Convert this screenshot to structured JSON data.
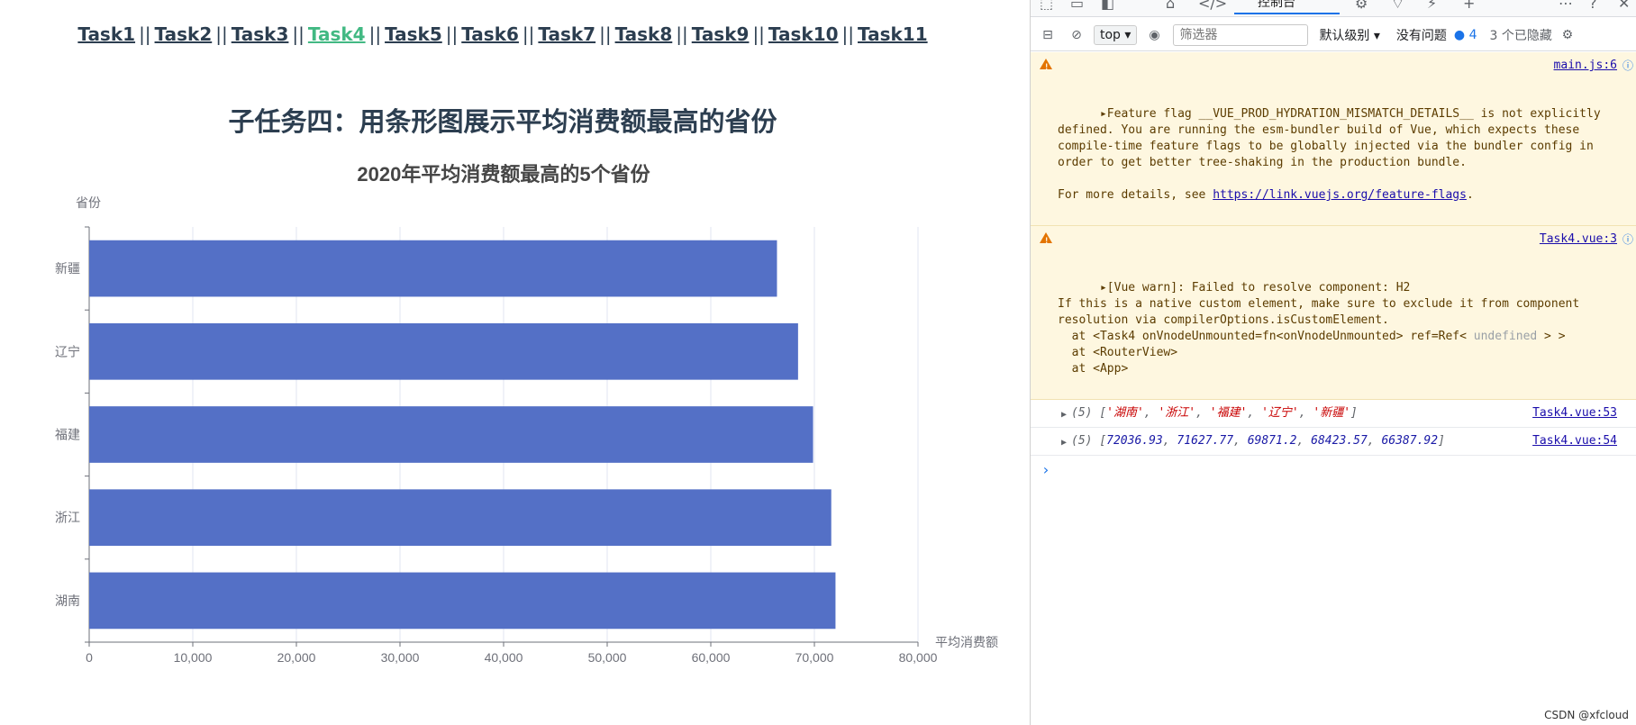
{
  "nav": {
    "links": [
      {
        "label": "Task1",
        "active": false
      },
      {
        "label": "Task2",
        "active": false
      },
      {
        "label": "Task3",
        "active": false
      },
      {
        "label": "Task4",
        "active": true
      },
      {
        "label": "Task5",
        "active": false
      },
      {
        "label": "Task6",
        "active": false
      },
      {
        "label": "Task7",
        "active": false
      },
      {
        "label": "Task8",
        "active": false
      },
      {
        "label": "Task9",
        "active": false
      },
      {
        "label": "Task10",
        "active": false
      },
      {
        "label": "Task11",
        "active": false
      }
    ],
    "separator": "||"
  },
  "page": {
    "heading": "子任务四：用条形图展示平均消费额最高的省份"
  },
  "chart_data": {
    "type": "bar",
    "orientation": "horizontal",
    "title": "2020年平均消费额最高的5个省份",
    "ylabel": "省份",
    "xlabel": "平均消费额",
    "categories": [
      "湖南",
      "浙江",
      "福建",
      "辽宁",
      "新疆"
    ],
    "values": [
      72036.93,
      71627.77,
      69871.2,
      68423.57,
      66387.92
    ],
    "xlim": [
      0,
      80000
    ],
    "xticks": [
      "0",
      "10,000",
      "20,000",
      "30,000",
      "40,000",
      "50,000",
      "60,000",
      "70,000",
      "80,000"
    ],
    "bar_color": "#5470c6",
    "grid": true
  },
  "devtools": {
    "active_tab": "控制台",
    "toolbar": {
      "context": "top",
      "filter_placeholder": "筛选器",
      "levels": "默认级别 ▾",
      "issues": "没有问题",
      "message_count": "4",
      "hidden": "3 个已隐藏"
    },
    "messages": {
      "warn1": {
        "text": "Feature flag __VUE_PROD_HYDRATION_MISMATCH_DETAILS__ is not explicitly defined. You are running the esm-bundler build of Vue, which expects these compile-time feature flags to be globally injected via the bundler config in order to get better tree-shaking in the production bundle.",
        "more_prefix": "For more details, see ",
        "link": "https://link.vuejs.org/feature-flags",
        "more_suffix": ".",
        "source": "main.js:6"
      },
      "warn2": {
        "line1": "[Vue warn]: Failed to resolve component: H2",
        "line2": "If this is a native custom element, make sure to exclude it from component resolution via compilerOptions.isCustomElement.",
        "line3_pre": "  at <Task4 onVnodeUnmounted=fn<onVnodeUnmounted> ref=Ref< ",
        "line3_undef": "undefined",
        "line3_post": " > >",
        "line4": "  at <RouterView>",
        "line5": "  at <App>",
        "source": "Task4.vue:3"
      },
      "log1": {
        "length": "(5)",
        "items": [
          "湖南",
          "浙江",
          "福建",
          "辽宁",
          "新疆"
        ],
        "source": "Task4.vue:53"
      },
      "log2": {
        "length": "(5)",
        "items": [
          "72036.93",
          "71627.77",
          "69871.2",
          "68423.57",
          "66387.92"
        ],
        "source": "Task4.vue:54"
      }
    },
    "prompt": "›"
  },
  "watermark": "CSDN @xfcloud"
}
